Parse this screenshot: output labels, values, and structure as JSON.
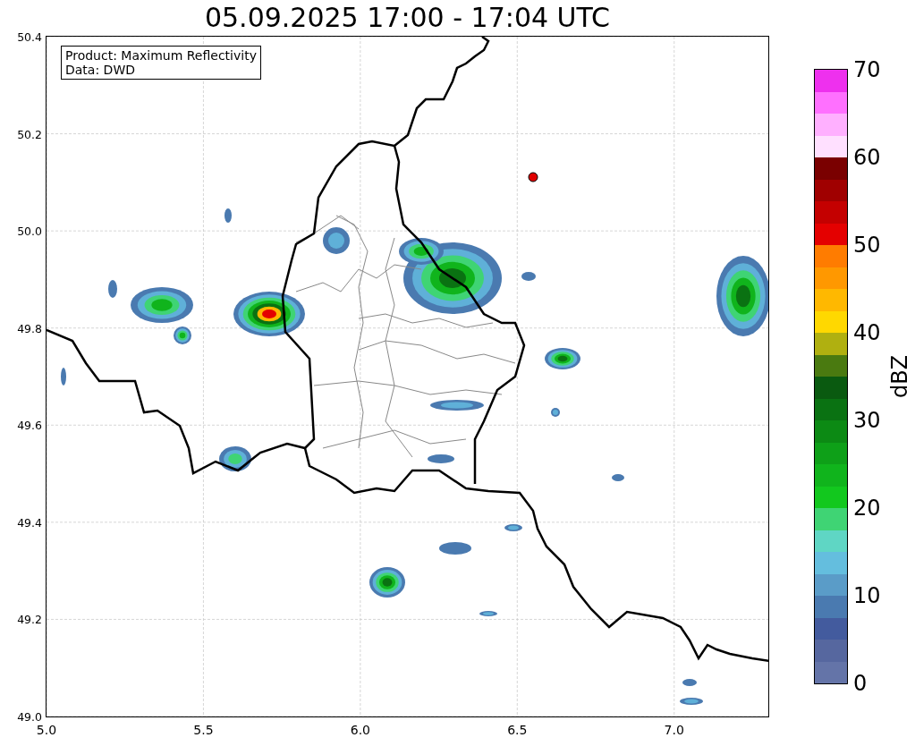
{
  "title": "05.09.2025 17:00 - 17:04 UTC",
  "info_box": [
    "Product: Maximum Reflectivity",
    "Data: DWD"
  ],
  "x_ticks": [
    "5.0",
    "5.5",
    "6.0",
    "6.5",
    "7.0"
  ],
  "y_ticks": [
    "50.4",
    "50.2",
    "50.0",
    "49.8",
    "49.6",
    "49.4",
    "49.2",
    "49.0"
  ],
  "colorbar": {
    "label": "dBZ",
    "ticks": [
      "70",
      "60",
      "50",
      "40",
      "30",
      "20",
      "10",
      "0"
    ],
    "segments": [
      {
        "color": "#6474a8"
      },
      {
        "color": "#56679f"
      },
      {
        "color": "#435b9e"
      },
      {
        "color": "#4a7ab0"
      },
      {
        "color": "#5a9cc8"
      },
      {
        "color": "#64bede"
      },
      {
        "color": "#5fd6c4"
      },
      {
        "color": "#3fd474"
      },
      {
        "color": "#12c81e"
      },
      {
        "color": "#10b41c"
      },
      {
        "color": "#0ea018"
      },
      {
        "color": "#0c8a14"
      },
      {
        "color": "#0a7212"
      },
      {
        "color": "#0a5a10"
      },
      {
        "color": "#4a7a10"
      },
      {
        "color": "#b0b010"
      },
      {
        "color": "#ffd800"
      },
      {
        "color": "#ffb800"
      },
      {
        "color": "#ff9800"
      },
      {
        "color": "#ff7c00"
      },
      {
        "color": "#e40000"
      },
      {
        "color": "#c40000"
      },
      {
        "color": "#a00000"
      },
      {
        "color": "#7a0000"
      },
      {
        "color": "#ffe0ff"
      },
      {
        "color": "#ffb0ff"
      },
      {
        "color": "#ff70ff"
      },
      {
        "color": "#ee30ee"
      }
    ]
  }
}
